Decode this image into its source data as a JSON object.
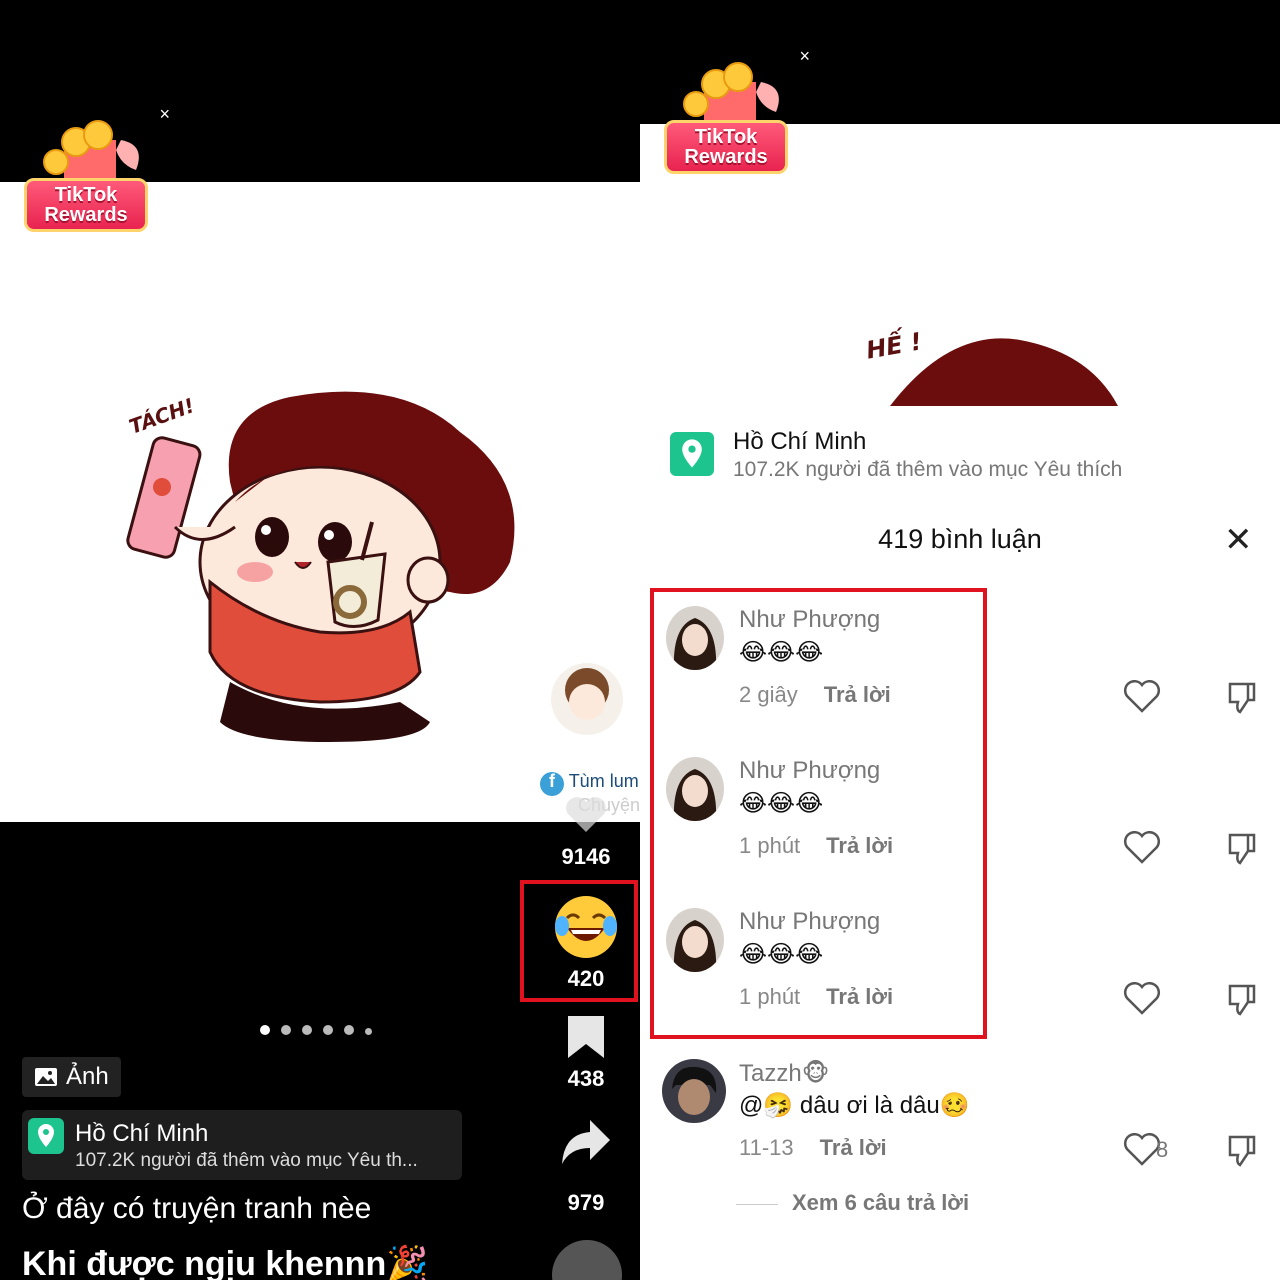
{
  "rewards": {
    "line1": "TikTok",
    "line2": "Rewards",
    "close": "×"
  },
  "left": {
    "sticker_text": "TÁCH!",
    "watermark": {
      "line1": "Tùm lum",
      "line2": "Chuyện"
    },
    "actions": {
      "likes": "9146",
      "reactions": "420",
      "saves": "438",
      "shares": "979"
    },
    "photo_tag": "Ảnh",
    "location": {
      "name": "Hồ Chí Minh",
      "sub": "107.2K người đã thêm vào mục Yêu th..."
    },
    "caption_line1": "Ở đây có truyện tranh nèe",
    "caption_line2": "Khi được ngịu khennn🎉"
  },
  "right": {
    "sticker_text": "HẾ !",
    "location": {
      "name": "Hồ Chí Minh",
      "sub": "107.2K người đã thêm vào mục Yêu thích"
    },
    "comments_title": "419 bình luận",
    "close": "✕",
    "comments": [
      {
        "user": "Như Phượng",
        "text": "😂😂😂",
        "time": "2 giây",
        "reply": "Trả lời",
        "likes": ""
      },
      {
        "user": "Như Phượng",
        "text": "😂😂😂",
        "time": "1 phút",
        "reply": "Trả lời",
        "likes": ""
      },
      {
        "user": "Như Phượng",
        "text": "😂😂😂",
        "time": "1 phút",
        "reply": "Trả lời",
        "likes": ""
      },
      {
        "user": "Tazzh🐵",
        "text": "@🤧 dâu ơi là dâu🥴",
        "time": "11-13",
        "reply": "Trả lời",
        "likes": "8"
      }
    ],
    "view_replies": "Xem 6 câu trả lời"
  },
  "colors": {
    "highlight": "#e0121f",
    "location_pin": "#1ec48e",
    "rewards": "#e8234f"
  }
}
